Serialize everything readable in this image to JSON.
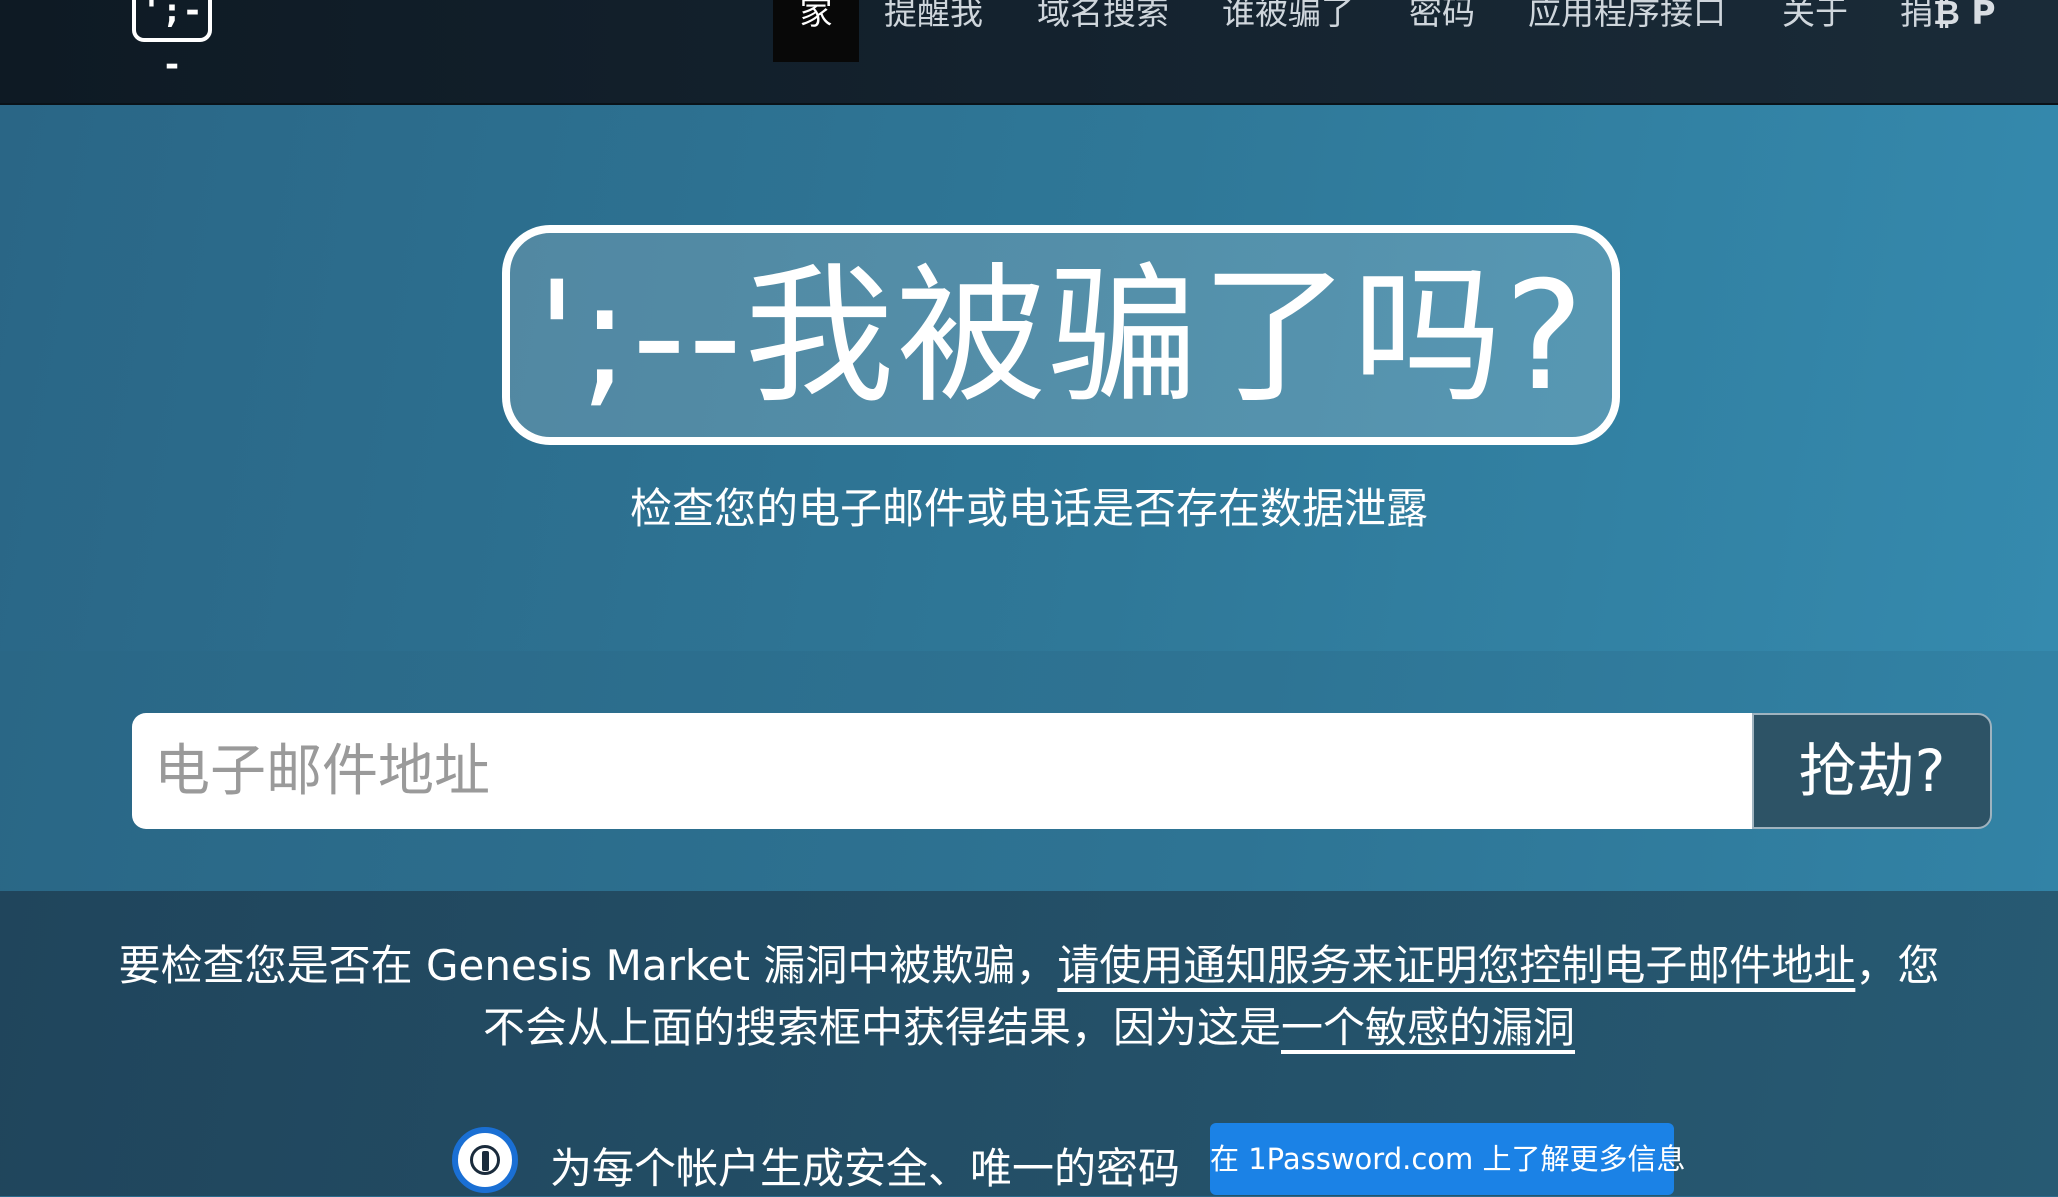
{
  "nav": {
    "logo": "';--",
    "items": [
      "家",
      "提醒我",
      "域名搜索",
      "谁被骗了",
      "密码",
      "应用程序接口",
      "关于",
      "捐"
    ],
    "donate_icons": "₿ P"
  },
  "hero": {
    "title": "';--我被骗了吗?",
    "subtitle": "检查您的电子邮件或电话是否存在数据泄露"
  },
  "search": {
    "placeholder": "电子邮件地址",
    "button_label": "抢劫?"
  },
  "notice": {
    "text_before": "要检查您是否在 Genesis Market 漏洞中被欺骗，",
    "link_notify": "请使用通知服务来证明您控制电子邮件地址",
    "text_middle": "，您不会从上面的搜索框中获得结果，因为这是",
    "link_sensitive": "一个敏感的漏洞"
  },
  "promo": {
    "icon": "1password-icon",
    "text": "为每个帐户生成安全、唯一的密码",
    "button_label": "在 1Password.com 上了解更多信息"
  }
}
